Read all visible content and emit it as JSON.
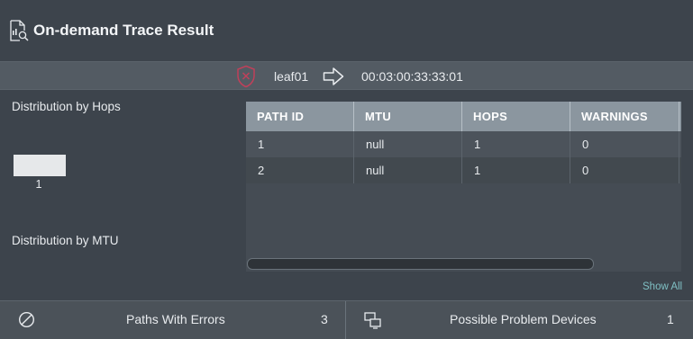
{
  "header": {
    "title": "On-demand Trace Result",
    "icon": "document-search-icon"
  },
  "trace": {
    "source": "leaf01",
    "destination": "00:03:00:33:33:01",
    "status_icon": "shield-x-icon",
    "arrow_icon": "arrow-right-icon"
  },
  "distribution": {
    "hops_label": "Distribution by Hops",
    "hops_ticks": [
      "1"
    ],
    "mtu_label": "Distribution by MTU"
  },
  "table": {
    "columns": [
      "PATH ID",
      "MTU",
      "HOPS",
      "WARNINGS"
    ],
    "rows": [
      [
        "1",
        "null",
        "1",
        "0"
      ],
      [
        "2",
        "null",
        "1",
        "0"
      ]
    ]
  },
  "show_all": "Show All",
  "footer": {
    "errors_label": "Paths With Errors",
    "errors_count": "3",
    "problem_label": "Possible Problem Devices",
    "problem_count": "1"
  },
  "colors": {
    "accent_link": "#7fc0c4",
    "header_row": "#8b969f",
    "status_red": "#c0405a"
  }
}
